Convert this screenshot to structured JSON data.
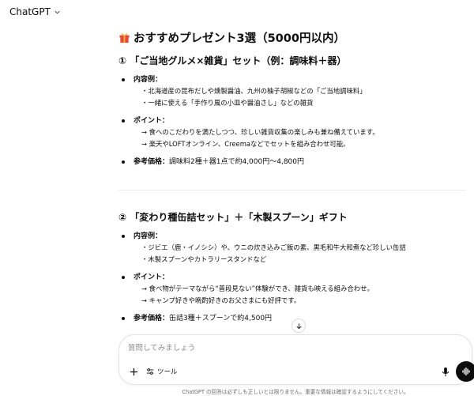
{
  "header": {
    "model_name": "ChatGPT"
  },
  "message": {
    "title": "おすすめプレゼント3選（5000円以内）",
    "sections": [
      {
        "heading": "① 「ご当地グルメ×雑貨」セット（例：調味料＋器）",
        "contents_label": "内容例：",
        "contents": [
          "・北海道産の昆布だしや燻製醤油、九州の柚子胡椒などの「ご当地調味料」",
          "・一緒に使える「手作り風の小皿や醤油さし」などの雑貨"
        ],
        "points_label": "ポイント：",
        "points": [
          "→ 食へのこだわりを満たしつつ、珍しい雑貨収集の楽しみも兼ね備えています。",
          "→ 楽天やLOFTオンライン、Creemaなどでセットを組み合わせ可能。"
        ],
        "price_label": "参考価格：",
        "price": "調味料2種＋器1点で約4,000円〜4,800円"
      },
      {
        "heading": "② 「変わり種缶詰セット」＋「木製スプーン」ギフト",
        "contents_label": "内容例：",
        "contents": [
          "・ジビエ（鹿・イノシシ）や、ウニの炊き込みご飯の素、黒毛和牛大和煮など珍しい缶詰",
          "・木製スプーンやカトラリースタンドなど"
        ],
        "points_label": "ポイント：",
        "points": [
          "→ 食べ物がテーマながら“普段見ない”体験ができ、雑貨も映える組み合わせ。",
          "→ キャンプ好きや晩酌好きのお父さまにも好評です。"
        ],
        "price_label": "参考価格：",
        "price": "缶詰3種＋スプーンで約4,500円"
      }
    ]
  },
  "composer": {
    "placeholder": "質問してみましょう",
    "tools_label": "ツール"
  },
  "footer": {
    "disclaimer": "ChatGPT の回答は必ずしも正しいとは限りません。重要な情報は確認するようにしてください。"
  },
  "icons": {
    "model_chevron": "chevron-down-icon",
    "title_emoji": "gift-icon",
    "scroll": "arrow-down-icon",
    "plus": "plus-icon",
    "tools": "sliders-icon",
    "mic": "microphone-icon",
    "voice": "voice-waveform-icon"
  },
  "colors": {
    "text": "#0d0d0d",
    "gift_red": "#e8473c",
    "gift_yellow": "#f5b82e",
    "voice_button": "#0d0d0d"
  }
}
